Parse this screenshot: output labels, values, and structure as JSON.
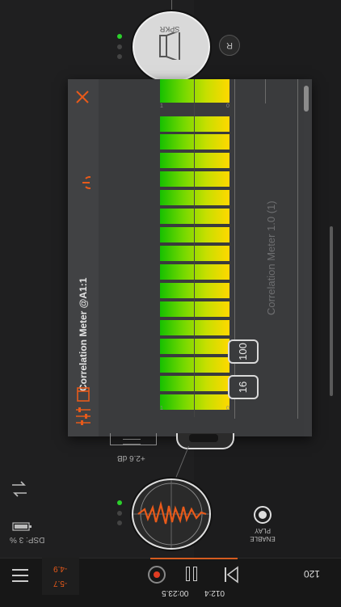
{
  "colors": {
    "accent": "#e85a1a",
    "active_dot": "#2bd12b",
    "meter_low": "#16c000",
    "meter_high": "#ffd800"
  },
  "top_node": {
    "label": "SPKR",
    "side_button": "R",
    "icon": "speaker-icon"
  },
  "panel": {
    "title": "Correlation Meter @A1:1",
    "plugin_name": "Correlation Meter 1.0 (1)",
    "buttons": {
      "a": "100",
      "b": "16"
    },
    "icons": [
      "close-icon",
      "power-icon",
      "book-icon",
      "mixer-icon"
    ]
  },
  "meter": {
    "scale_left": "1",
    "scale_right": "0",
    "top_scale_left": "1",
    "top_scale_right": "0"
  },
  "audio_node": {
    "icon": "waveform-icon"
  },
  "gain": {
    "label": "+2.6 dB"
  },
  "status": {
    "dsp": "DSP: 3 %"
  },
  "play_enable": {
    "line1": "PLAY",
    "line2": "ENABLE"
  },
  "transport": {
    "level_top": "-4.9",
    "level_bottom": "-5.7",
    "time_a": "00:23.5",
    "time_b": "012:4",
    "bpm": "120"
  }
}
